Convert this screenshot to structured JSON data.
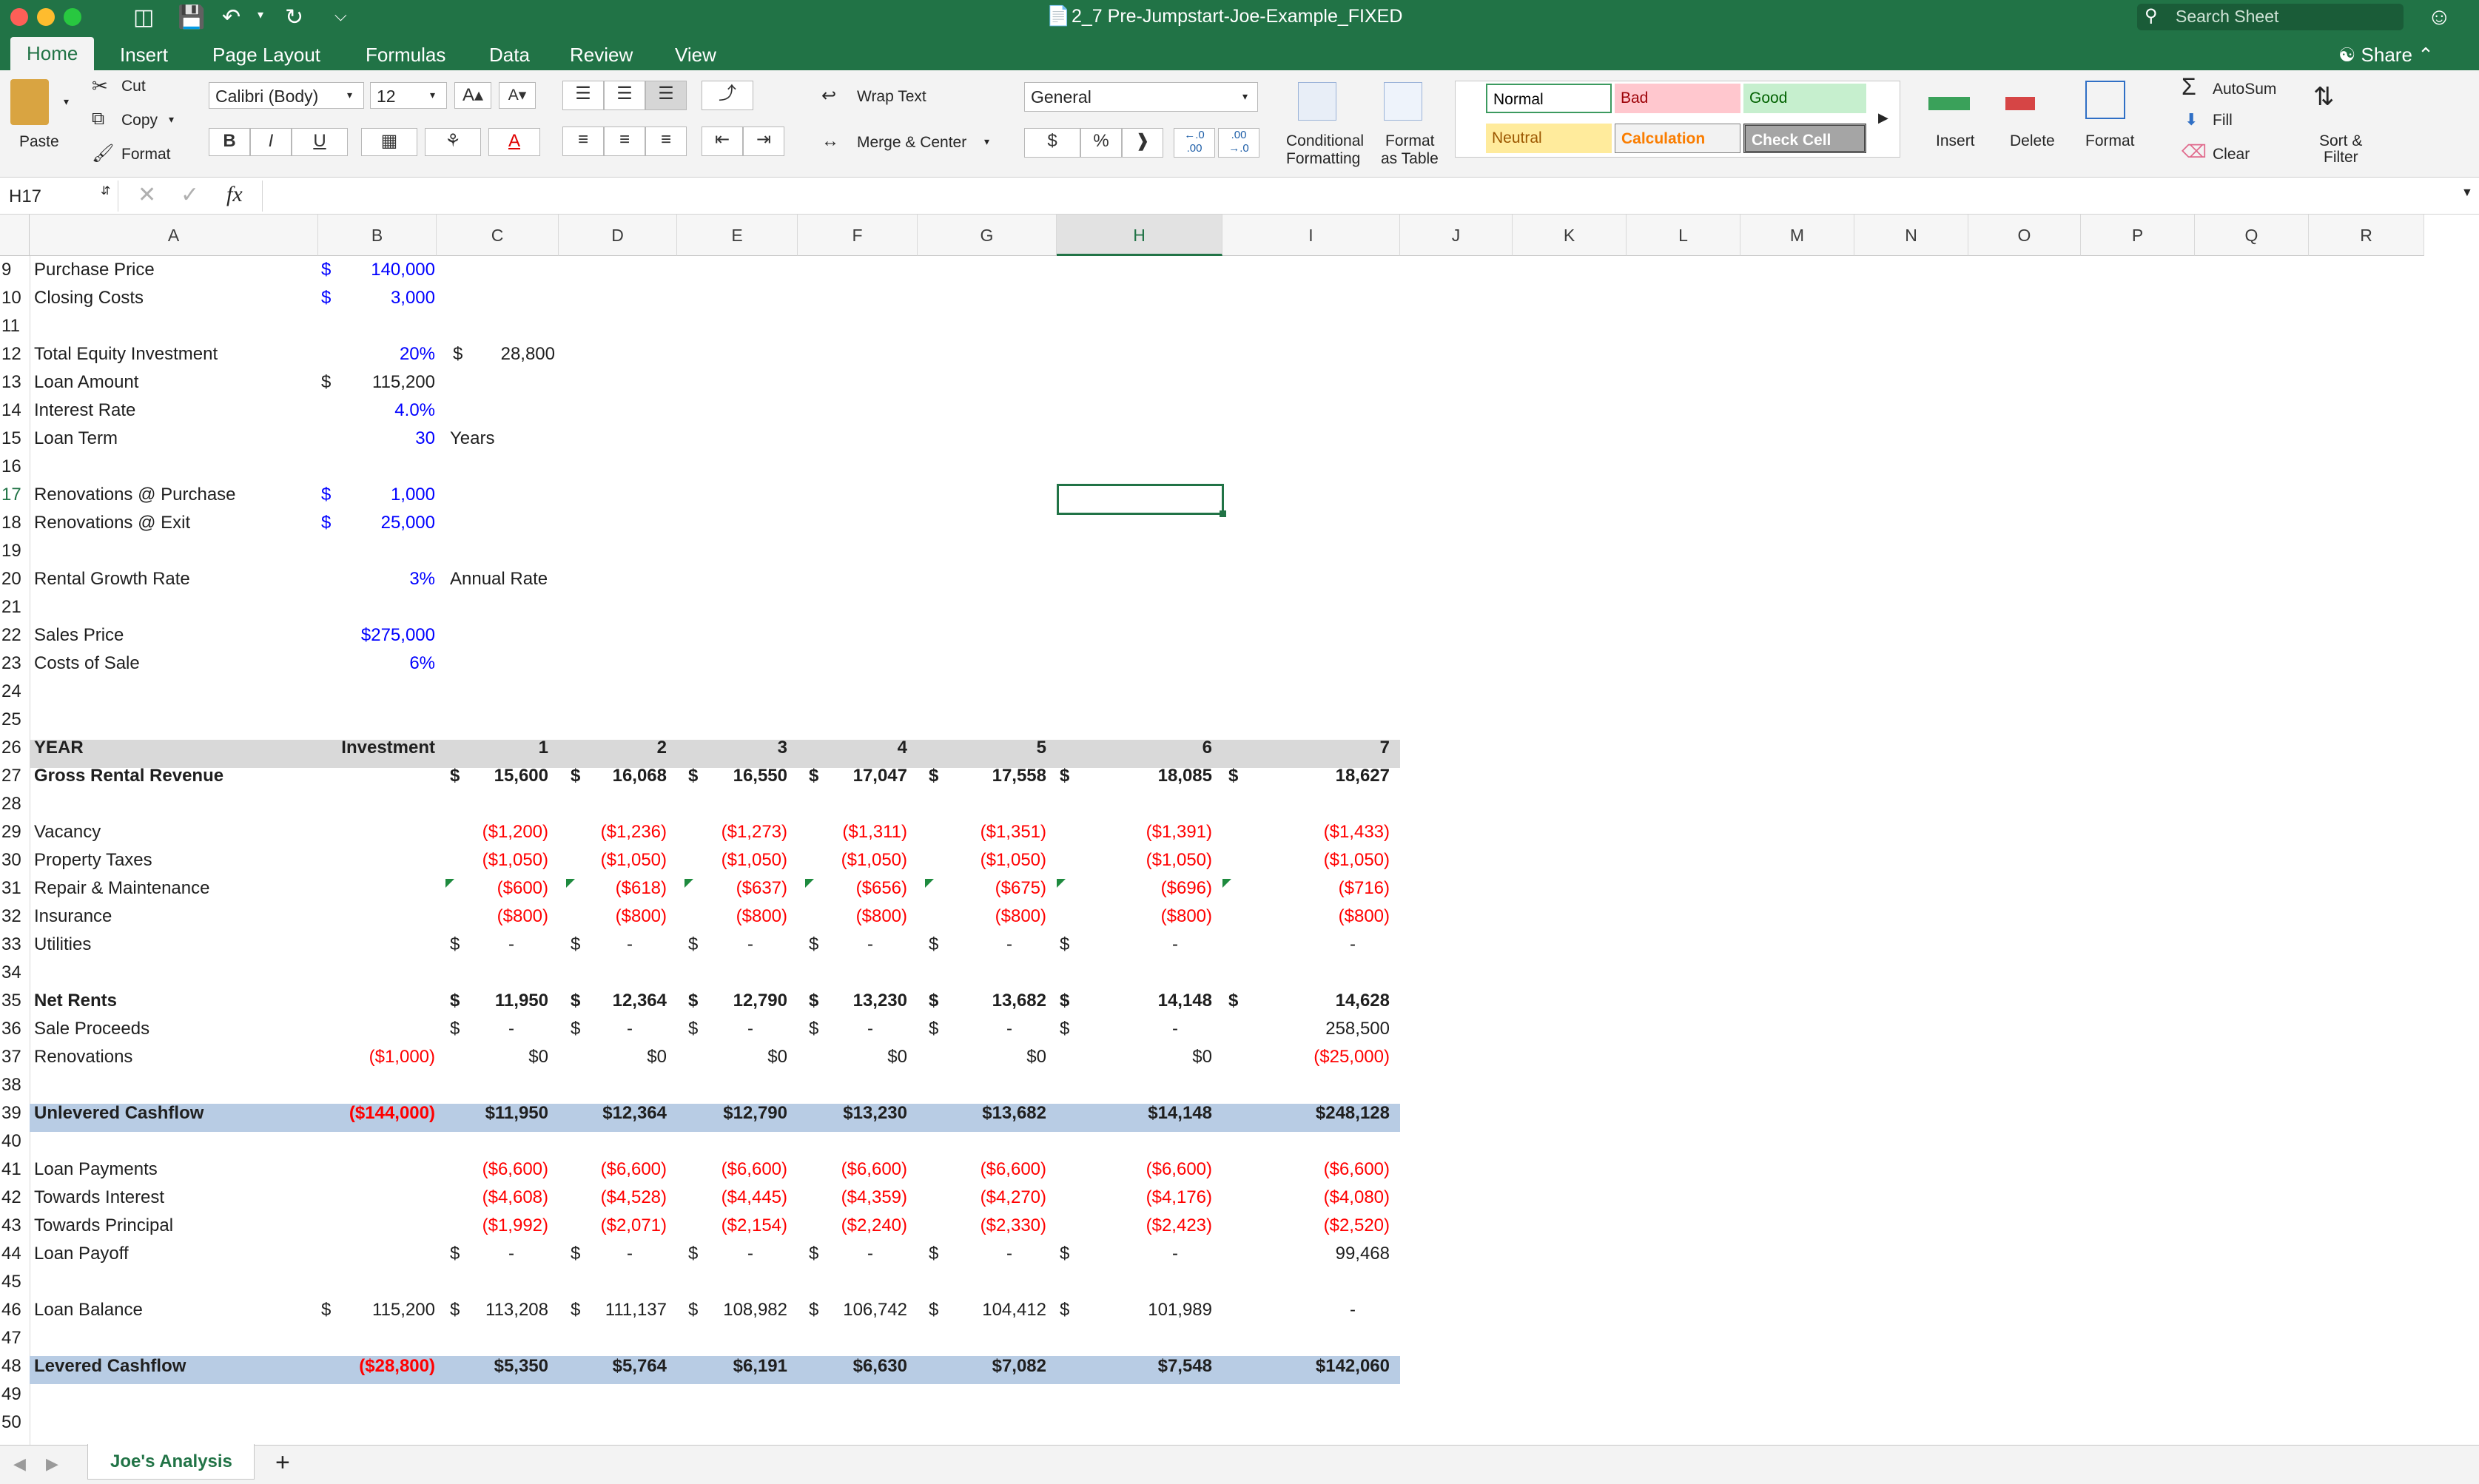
{
  "window": {
    "title": "2_7 Pre-Jumpstart-Joe-Example_FIXED",
    "search_placeholder": "Search Sheet",
    "share_label": "Share"
  },
  "tabs": [
    "Home",
    "Insert",
    "Page Layout",
    "Formulas",
    "Data",
    "Review",
    "View"
  ],
  "ribbon": {
    "paste": "Paste",
    "cut": "Cut",
    "copy": "Copy",
    "format_painter": "Format",
    "font_name": "Calibri (Body)",
    "font_size": "12",
    "bold": "B",
    "italic": "I",
    "underline": "U",
    "wrap_text": "Wrap Text",
    "merge_center": "Merge & Center",
    "number_format": "General",
    "currency": "$",
    "percent": "%",
    "comma": "❱",
    "conditional_formatting_1": "Conditional",
    "conditional_formatting_2": "Formatting",
    "format_as_table_1": "Format",
    "format_as_table_2": "as Table",
    "styles": {
      "normal": "Normal",
      "bad": "Bad",
      "good": "Good",
      "neutral": "Neutral",
      "calculation": "Calculation",
      "check_cell": "Check Cell"
    },
    "insert": "Insert",
    "delete": "Delete",
    "format": "Format",
    "autosum": "AutoSum",
    "fill": "Fill",
    "clear": "Clear",
    "sort_filter_1": "Sort &",
    "sort_filter_2": "Filter"
  },
  "formula_bar": {
    "name_box": "H17",
    "fx": "fx",
    "content": ""
  },
  "columns": [
    "A",
    "B",
    "C",
    "D",
    "E",
    "F",
    "G",
    "H",
    "I",
    "J",
    "K",
    "L",
    "M",
    "N",
    "O",
    "P",
    "Q",
    "R"
  ],
  "rows": {
    "r9": {
      "num": "9",
      "a": "Purchase Price",
      "b_sym": "$",
      "b": "140,000"
    },
    "r10": {
      "num": "10",
      "a": "Closing Costs",
      "b_sym": "$",
      "b": "3,000"
    },
    "r11": {
      "num": "11"
    },
    "r12": {
      "num": "12",
      "a": "Total Equity Investment",
      "b": "20%",
      "c_sym": "$",
      "c": "28,800"
    },
    "r13": {
      "num": "13",
      "a": "Loan Amount",
      "b_sym": "$",
      "b": "115,200"
    },
    "r14": {
      "num": "14",
      "a": "Interest Rate",
      "b": "4.0%"
    },
    "r15": {
      "num": "15",
      "a": "Loan Term",
      "b": "30",
      "c": "Years"
    },
    "r16": {
      "num": "16"
    },
    "r17": {
      "num": "17",
      "a": "Renovations @ Purchase",
      "b_sym": "$",
      "b": "1,000"
    },
    "r18": {
      "num": "18",
      "a": "Renovations @ Exit",
      "b_sym": "$",
      "b": "25,000"
    },
    "r19": {
      "num": "19"
    },
    "r20": {
      "num": "20",
      "a": "Rental Growth Rate",
      "b": "3%",
      "c": "Annual Rate"
    },
    "r21": {
      "num": "21"
    },
    "r22": {
      "num": "22",
      "a": "Sales Price",
      "b": "$275,000"
    },
    "r23": {
      "num": "23",
      "a": "Costs of Sale",
      "b": "6%"
    },
    "r24": {
      "num": "24"
    },
    "r25": {
      "num": "25"
    },
    "r26": {
      "num": "26",
      "a": "YEAR",
      "b": "Investment",
      "years": [
        "1",
        "2",
        "3",
        "4",
        "5",
        "6",
        "7"
      ]
    },
    "r27": {
      "num": "27",
      "a": "Gross Rental Revenue",
      "vals": [
        "15,600",
        "16,068",
        "16,550",
        "17,047",
        "17,558",
        "18,085",
        "18,627"
      ]
    },
    "r28": {
      "num": "28"
    },
    "r29": {
      "num": "29",
      "a": "Vacancy",
      "vals": [
        "($1,200)",
        "($1,236)",
        "($1,273)",
        "($1,311)",
        "($1,351)",
        "($1,391)",
        "($1,433)"
      ]
    },
    "r30": {
      "num": "30",
      "a": "Property Taxes",
      "vals": [
        "($1,050)",
        "($1,050)",
        "($1,050)",
        "($1,050)",
        "($1,050)",
        "($1,050)",
        "($1,050)"
      ]
    },
    "r31": {
      "num": "31",
      "a": "Repair & Maintenance",
      "vals": [
        "($600)",
        "($618)",
        "($637)",
        "($656)",
        "($675)",
        "($696)",
        "($716)"
      ]
    },
    "r32": {
      "num": "32",
      "a": "Insurance",
      "vals": [
        "($800)",
        "($800)",
        "($800)",
        "($800)",
        "($800)",
        "($800)",
        "($800)"
      ]
    },
    "r33": {
      "num": "33",
      "a": "Utilities",
      "vals": [
        "-",
        "-",
        "-",
        "-",
        "-",
        "-",
        "-"
      ]
    },
    "r34": {
      "num": "34"
    },
    "r35": {
      "num": "35",
      "a": "Net Rents",
      "vals": [
        "11,950",
        "12,364",
        "12,790",
        "13,230",
        "13,682",
        "14,148",
        "14,628"
      ]
    },
    "r36": {
      "num": "36",
      "a": "Sale Proceeds",
      "vals": [
        "-",
        "-",
        "-",
        "-",
        "-",
        "-",
        "258,500"
      ]
    },
    "r37": {
      "num": "37",
      "a": "Renovations",
      "b": "($1,000)",
      "vals": [
        "$0",
        "$0",
        "$0",
        "$0",
        "$0",
        "$0",
        "($25,000)"
      ]
    },
    "r38": {
      "num": "38"
    },
    "r39": {
      "num": "39",
      "a": "Unlevered Cashflow",
      "b": "($144,000)",
      "vals": [
        "$11,950",
        "$12,364",
        "$12,790",
        "$13,230",
        "$13,682",
        "$14,148",
        "$248,128"
      ]
    },
    "r40": {
      "num": "40"
    },
    "r41": {
      "num": "41",
      "a": "Loan Payments",
      "vals": [
        "($6,600)",
        "($6,600)",
        "($6,600)",
        "($6,600)",
        "($6,600)",
        "($6,600)",
        "($6,600)"
      ]
    },
    "r42": {
      "num": "42",
      "a": "Towards Interest",
      "vals": [
        "($4,608)",
        "($4,528)",
        "($4,445)",
        "($4,359)",
        "($4,270)",
        "($4,176)",
        "($4,080)"
      ]
    },
    "r43": {
      "num": "43",
      "a": "Towards Principal",
      "vals": [
        "($1,992)",
        "($2,071)",
        "($2,154)",
        "($2,240)",
        "($2,330)",
        "($2,423)",
        "($2,520)"
      ]
    },
    "r44": {
      "num": "44",
      "a": "Loan Payoff",
      "vals": [
        "-",
        "-",
        "-",
        "-",
        "-",
        "-",
        "99,468"
      ]
    },
    "r45": {
      "num": "45"
    },
    "r46": {
      "num": "46",
      "a": "Loan Balance",
      "b_sym": "$",
      "b": "115,200",
      "vals": [
        "113,208",
        "111,137",
        "108,982",
        "106,742",
        "104,412",
        "101,989",
        "-"
      ]
    },
    "r47": {
      "num": "47"
    },
    "r48": {
      "num": "48",
      "a": "Levered Cashflow",
      "b": "($28,800)",
      "vals": [
        "$5,350",
        "$5,764",
        "$6,191",
        "$6,630",
        "$7,082",
        "$7,548",
        "$142,060"
      ]
    },
    "r49": {
      "num": "49"
    },
    "r50": {
      "num": "50"
    }
  },
  "currency_symbol": "$",
  "sheet_tabs": [
    "Joe's Analysis"
  ],
  "add_sheet": "+",
  "colors": {
    "excel_green": "#217346",
    "input_blue": "#0000ff",
    "negative_red": "#ff0000",
    "total_band": "#b8cce4",
    "header_band": "#d9d9d9"
  }
}
